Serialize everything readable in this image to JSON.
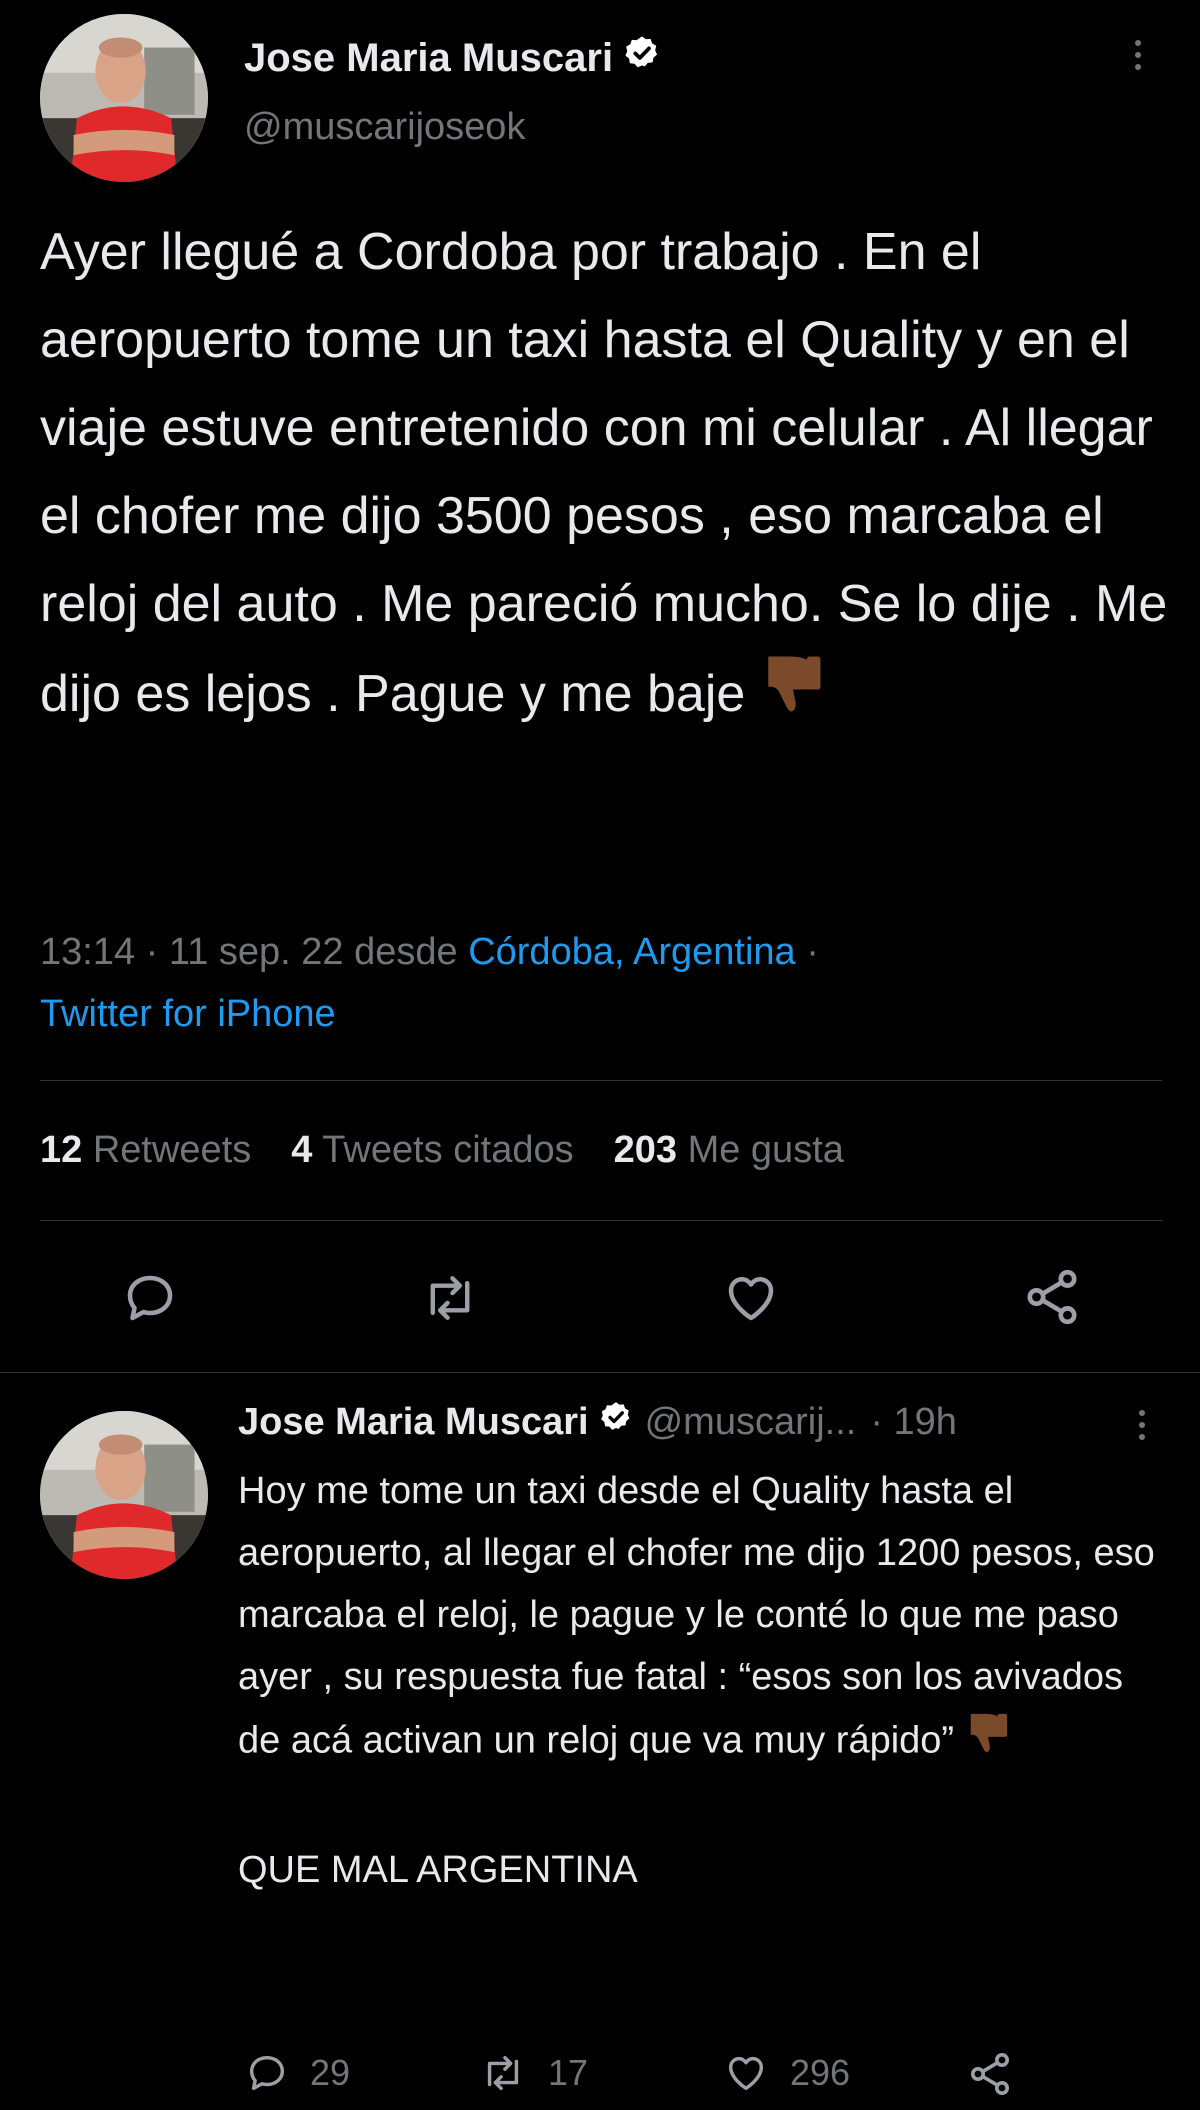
{
  "main_tweet": {
    "author_name": "Jose Maria Muscari",
    "handle": "@muscarijoseok",
    "text": "Ayer llegué a Cordoba por trabajo . En el aeropuerto tome un taxi hasta el Quality y en el viaje estuve entretenido con mi celular . Al llegar el chofer me dijo 3500 pesos , eso marcaba el reloj del auto . Me pareció mucho. Se lo dije . Me dijo es lejos . Pague y me baje",
    "time": "13:14",
    "separator": "·",
    "date": "11 sep. 22",
    "from_label": "desde",
    "location": "Córdoba, Argentina",
    "source": "Twitter for iPhone",
    "stats": {
      "retweets_count": "12",
      "retweets_label": "Retweets",
      "quotes_count": "4",
      "quotes_label": "Tweets citados",
      "likes_count": "203",
      "likes_label": "Me gusta"
    },
    "icons": [
      "reply-icon",
      "retweet-icon",
      "like-icon",
      "share-icon",
      "thumbs-down-emoji",
      "verified-badge-icon",
      "more-options-icon"
    ]
  },
  "reply_tweet": {
    "author_name": "Jose Maria Muscari",
    "handle": "@muscarij...",
    "time": "· 19h",
    "paragraph1": "Hoy me tome un taxi desde el Quality hasta el aeropuerto, al llegar el chofer me dijo 1200 pesos, eso marcaba el reloj, le pague y le conté lo que me paso ayer , su respuesta fue fatal : “esos son los avivados de acá activan un reloj que va muy rápido”",
    "paragraph2": "QUE MAL ARGENTINA",
    "reply_count": "29",
    "retweet_count": "17",
    "like_count": "296"
  },
  "colors": {
    "background": "#000000",
    "text": "#e7e9ea",
    "secondary": "#71767b",
    "link": "#1d9bf0",
    "divider": "#2f3336",
    "emoji": "#7a4a2a"
  }
}
